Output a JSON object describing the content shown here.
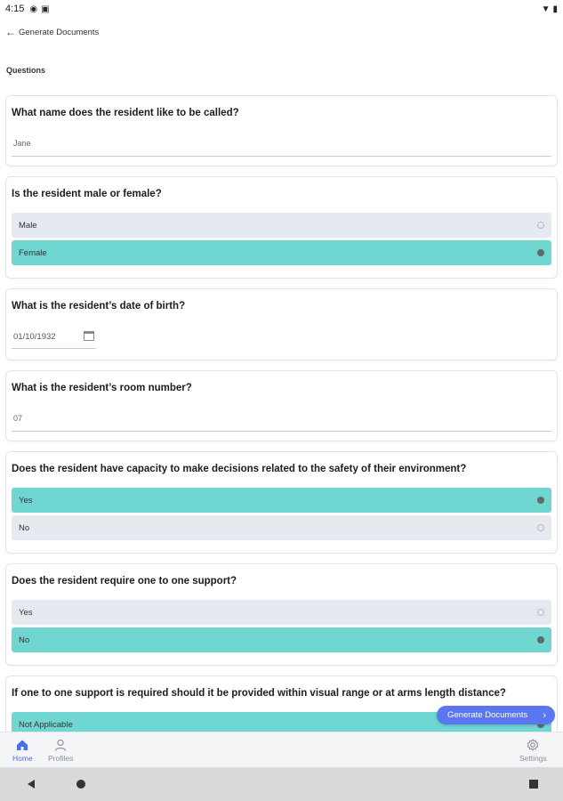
{
  "status_bar": {
    "time": "4:15",
    "icons": [
      "sync-icon",
      "sim-icon",
      "wifi-icon",
      "battery-icon"
    ]
  },
  "header": {
    "back_label": "Generate Documents"
  },
  "section_title": "Questions",
  "questions": [
    {
      "text": "What name does the resident like to be called?",
      "type": "text",
      "value": "Jane"
    },
    {
      "text": "Is the resident male or female?",
      "type": "choice",
      "options": [
        {
          "label": "Male",
          "selected": false
        },
        {
          "label": "Female",
          "selected": true
        }
      ]
    },
    {
      "text": "What is the resident’s date of birth?",
      "type": "date",
      "value": "01/10/1932"
    },
    {
      "text": "What is the resident’s room number?",
      "type": "text",
      "value": "07"
    },
    {
      "text": "Does the resident have capacity to make decisions related to the safety of their environment?",
      "type": "choice",
      "options": [
        {
          "label": "Yes",
          "selected": true
        },
        {
          "label": "No",
          "selected": false
        }
      ]
    },
    {
      "text": "Does the resident require one to one support?",
      "type": "choice",
      "options": [
        {
          "label": "Yes",
          "selected": false
        },
        {
          "label": "No",
          "selected": true
        }
      ]
    },
    {
      "text": "If one to one support is required should it be provided within visual range or at arms length distance?",
      "type": "choice",
      "options": [
        {
          "label": "Not Applicable",
          "selected": true
        }
      ]
    }
  ],
  "fab": {
    "label": "Generate Documents"
  },
  "bottom_nav": {
    "home": "Home",
    "profiles": "Profiles",
    "settings": "Settings"
  },
  "colors": {
    "selected_option": "#6fd6d2",
    "unselected_option": "#e6e9ef",
    "accent": "#5b77f0"
  }
}
